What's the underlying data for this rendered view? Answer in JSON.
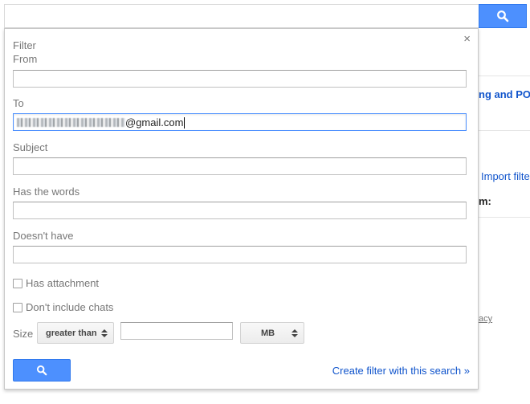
{
  "background": {
    "link_top": "ng and POP",
    "import_link": "Import filter",
    "bold_label": "m:",
    "small_link": "acy"
  },
  "search": {
    "value": "",
    "placeholder": "",
    "button_icon": "search-icon"
  },
  "filter": {
    "title": "Filter",
    "close_label": "×",
    "fields": {
      "from": {
        "label": "From",
        "value": ""
      },
      "to": {
        "label": "To",
        "value_visible": "@gmail.com",
        "redacted": true
      },
      "subject": {
        "label": "Subject",
        "value": ""
      },
      "has_words": {
        "label": "Has the words",
        "value": ""
      },
      "doesnt_have": {
        "label": "Doesn't have",
        "value": ""
      }
    },
    "checkboxes": {
      "has_attachment": {
        "label": "Has attachment",
        "checked": false
      },
      "dont_include_chats": {
        "label": "Don't include chats",
        "checked": false
      }
    },
    "size": {
      "label": "Size",
      "comparator": "greater than",
      "value": "",
      "unit": "MB"
    },
    "search_button_icon": "search-icon",
    "create_link": "Create filter with this search »"
  },
  "colors": {
    "accent_blue": "#4d90fe",
    "link_blue": "#1155cc",
    "label_gray": "#777777"
  }
}
